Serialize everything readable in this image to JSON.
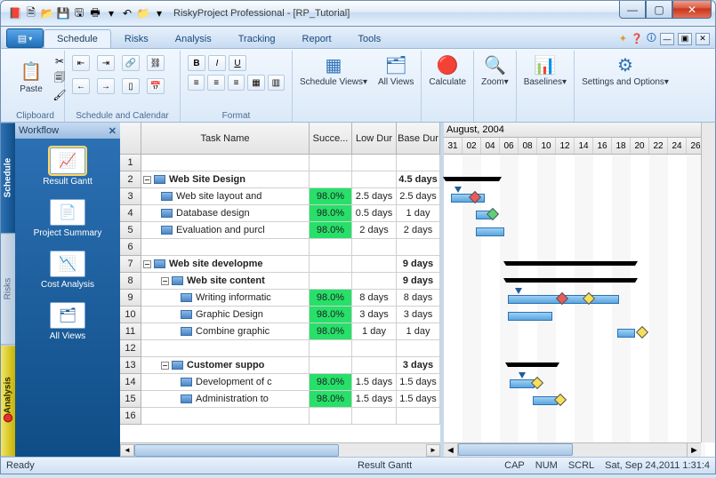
{
  "app": {
    "title": "RiskyProject Professional - [RP_Tutorial]"
  },
  "qat_icons": [
    "app",
    "new",
    "open",
    "save",
    "saveall",
    "print",
    "dd",
    "undo",
    "open2",
    "dd2"
  ],
  "win": {
    "min": "—",
    "max": "▢",
    "close": "✕"
  },
  "ribbon": {
    "file_icon": "▤▾",
    "tabs": [
      "Schedule",
      "Risks",
      "Analysis",
      "Tracking",
      "Report",
      "Tools"
    ],
    "groups": {
      "clipboard": {
        "label": "Clipboard",
        "paste": "Paste"
      },
      "schedcal": {
        "label": "Schedule and Calendar"
      },
      "format": {
        "label": "Format",
        "b": "B",
        "i": "I",
        "u": "U"
      },
      "views1": {
        "label": "Schedule Views▾"
      },
      "views2": {
        "label": "All Views"
      },
      "calc": {
        "label": "Calculate"
      },
      "zoom": {
        "label": "Zoom▾"
      },
      "base": {
        "label": "Baselines▾"
      },
      "settings": {
        "label": "Settings and Options▾"
      }
    },
    "help_icons": [
      "✦",
      "?",
      "?",
      "—",
      "▣",
      "✕"
    ]
  },
  "sidebar": {
    "tabs": [
      "Schedule",
      "Risks",
      "Analysis"
    ],
    "workflow_title": "Workflow",
    "workflow_close": "✕",
    "items": [
      {
        "label": "Result Gantt"
      },
      {
        "label": "Project Summary"
      },
      {
        "label": "Cost Analysis"
      },
      {
        "label": "All Views"
      }
    ]
  },
  "table": {
    "headers": {
      "num": "",
      "task": "Task Name",
      "succ": "Succe...",
      "low": "Low Dur",
      "base": "Base Dur"
    },
    "rows": [
      {
        "n": 1,
        "indent": 0,
        "toggle": false,
        "icon": false,
        "name": "",
        "succ": "",
        "low": "",
        "base": "",
        "bold": false
      },
      {
        "n": 2,
        "indent": 0,
        "toggle": true,
        "icon": true,
        "name": "Web Site Design",
        "succ": "",
        "low": "",
        "base": "4.5 days",
        "bold": true
      },
      {
        "n": 3,
        "indent": 1,
        "toggle": false,
        "icon": true,
        "name": "Web site layout and",
        "succ": "98.0%",
        "low": "2.5 days",
        "base": "2.5 days",
        "bold": false,
        "green": true
      },
      {
        "n": 4,
        "indent": 1,
        "toggle": false,
        "icon": true,
        "name": "Database design",
        "succ": "98.0%",
        "low": "0.5 days",
        "base": "1 day",
        "bold": false,
        "green": true
      },
      {
        "n": 5,
        "indent": 1,
        "toggle": false,
        "icon": true,
        "name": "Evaluation and purcl",
        "succ": "98.0%",
        "low": "2 days",
        "base": "2 days",
        "bold": false,
        "green": true
      },
      {
        "n": 6,
        "indent": 0,
        "toggle": false,
        "icon": false,
        "name": "",
        "succ": "",
        "low": "",
        "base": "",
        "bold": false
      },
      {
        "n": 7,
        "indent": 0,
        "toggle": true,
        "icon": true,
        "name": "Web site developme",
        "succ": "",
        "low": "",
        "base": "9 days",
        "bold": true
      },
      {
        "n": 8,
        "indent": 1,
        "toggle": true,
        "icon": true,
        "name": "Web site content",
        "succ": "",
        "low": "",
        "base": "9 days",
        "bold": true
      },
      {
        "n": 9,
        "indent": 2,
        "toggle": false,
        "icon": true,
        "name": "Writing informatic",
        "succ": "98.0%",
        "low": "8 days",
        "base": "8 days",
        "bold": false,
        "green": true
      },
      {
        "n": 10,
        "indent": 2,
        "toggle": false,
        "icon": true,
        "name": "Graphic Design",
        "succ": "98.0%",
        "low": "3 days",
        "base": "3 days",
        "bold": false,
        "green": true
      },
      {
        "n": 11,
        "indent": 2,
        "toggle": false,
        "icon": true,
        "name": "Combine graphic",
        "succ": "98.0%",
        "low": "1 day",
        "base": "1 day",
        "bold": false,
        "green": true
      },
      {
        "n": 12,
        "indent": 0,
        "toggle": false,
        "icon": false,
        "name": "",
        "succ": "",
        "low": "",
        "base": "",
        "bold": false
      },
      {
        "n": 13,
        "indent": 1,
        "toggle": true,
        "icon": true,
        "name": "Customer suppo",
        "succ": "",
        "low": "",
        "base": "3 days",
        "bold": true
      },
      {
        "n": 14,
        "indent": 2,
        "toggle": false,
        "icon": true,
        "name": "Development of c",
        "succ": "98.0%",
        "low": "1.5 days",
        "base": "1.5 days",
        "bold": false,
        "green": true
      },
      {
        "n": 15,
        "indent": 2,
        "toggle": false,
        "icon": true,
        "name": "Administration to",
        "succ": "98.0%",
        "low": "1.5 days",
        "base": "1.5 days",
        "bold": false,
        "green": true
      },
      {
        "n": 16,
        "indent": 0,
        "toggle": false,
        "icon": false,
        "name": "",
        "succ": "",
        "low": "",
        "base": "",
        "bold": false
      }
    ]
  },
  "gantt": {
    "month": "August, 2004",
    "days": [
      "31",
      "02",
      "04",
      "06",
      "08",
      "10",
      "12",
      "14",
      "16",
      "18",
      "20",
      "22",
      "24",
      "26"
    ]
  },
  "status": {
    "ready": "Ready",
    "view": "Result Gantt",
    "cap": "CAP",
    "num": "NUM",
    "scrl": "SCRL",
    "datetime": "Sat, Sep 24,2011  1:31:4"
  }
}
